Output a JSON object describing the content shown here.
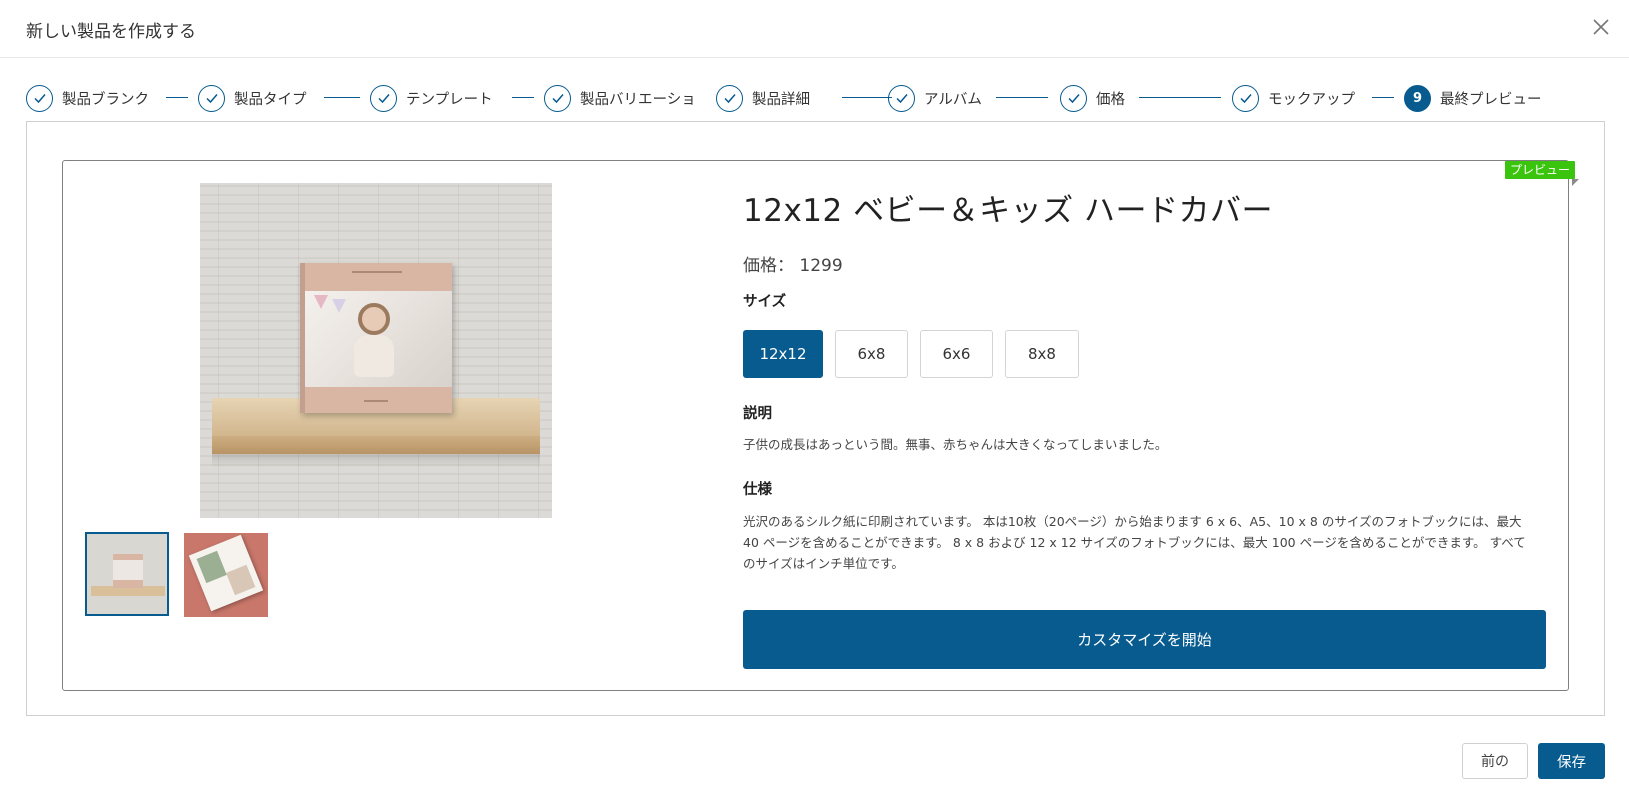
{
  "header": {
    "title": "新しい製品を作成する",
    "close_icon": "close-icon"
  },
  "stepper": {
    "steps": [
      {
        "label": "製品ブランク",
        "status": "complete"
      },
      {
        "label": "製品タイプ",
        "status": "complete"
      },
      {
        "label": "テンプレート",
        "status": "complete"
      },
      {
        "label": "製品バリエーショ",
        "status": "complete"
      },
      {
        "label": "製品詳細",
        "status": "complete"
      },
      {
        "label": "アルバム",
        "status": "complete"
      },
      {
        "label": "価格",
        "status": "complete"
      },
      {
        "label": "モックアップ",
        "status": "complete"
      },
      {
        "label": "最終プレビュー",
        "status": "active",
        "number": "9"
      }
    ]
  },
  "preview": {
    "ribbon": "プレビュー",
    "product_title": "12x12 ベビー＆キッズ ハードカバー",
    "price_label": "価格：",
    "price_value": "1299",
    "size_label": "サイズ",
    "sizes": [
      "12x12",
      "6x8",
      "6x6",
      "8x8"
    ],
    "selected_size": "12x12",
    "description_label": "説明",
    "description": "子供の成長はあっという間。無事、赤ちゃんは大きくなってしまいました。",
    "spec_label": "仕様",
    "spec": "光沢のあるシルク紙に印刷されています。 本は10枚（20ページ）から始まります 6 x 6、A5、10 x 8 のサイズのフォトブックには、最大 40 ページを含めることができます。 8 x 8 および 12 x 12 サイズのフォトブックには、最大 100 ページを含めることができます。 すべてのサイズはインチ単位です。",
    "customize_button": "カスタマイズを開始",
    "thumbnails": [
      "mockup-shelf-thumbnail",
      "open-book-thumbnail"
    ]
  },
  "footer": {
    "back_label": "前の",
    "save_label": "保存"
  },
  "colors": {
    "primary": "#075b8e",
    "ribbon": "#3ac40d"
  }
}
